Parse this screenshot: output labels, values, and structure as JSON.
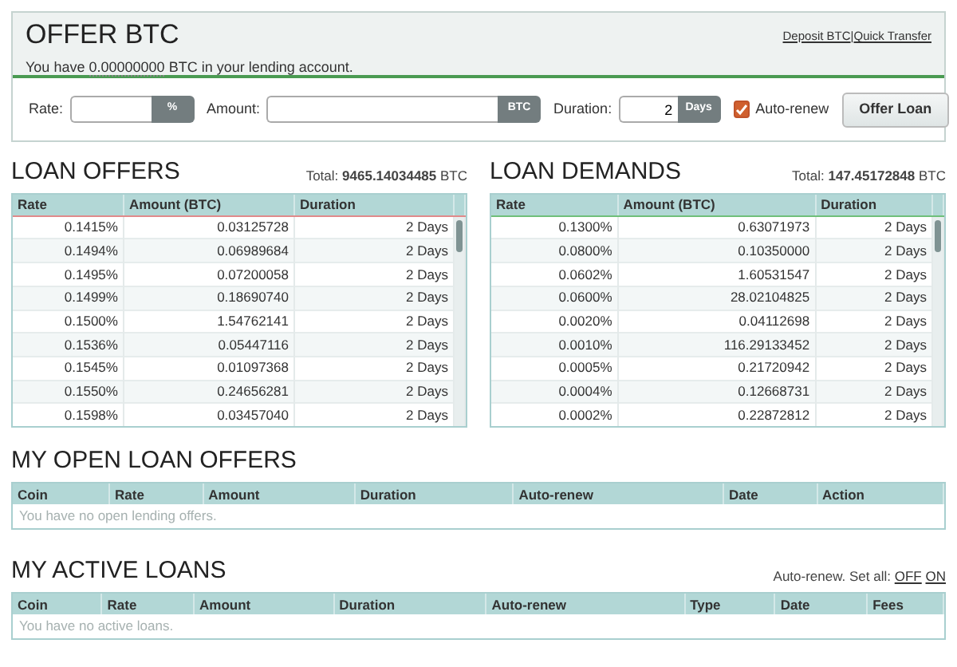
{
  "offer_panel": {
    "title": "OFFER BTC",
    "balance_text_before": "You have",
    "balance": "0.00000000",
    "balance_text_after": "BTC in your lending account.",
    "links": [
      "Deposit BTC",
      "Quick Transfer"
    ],
    "link_separator": "|",
    "form": {
      "rate_label": "Rate:",
      "rate_addon": "%",
      "amount_label": "Amount:",
      "amount_addon": "BTC",
      "duration_label": "Duration:",
      "duration_value": "2",
      "duration_addon": "Days",
      "auto_renew": {
        "label": "Auto-renew",
        "checked": true
      },
      "submit": "Offer Loan"
    }
  },
  "loan_offers": {
    "title": "LOAN OFFERS",
    "total_label": "Total:",
    "total": "9465.14034485",
    "total_unit": "BTC",
    "columns": [
      "Rate",
      "Amount (BTC)",
      "Duration"
    ],
    "rows": [
      [
        "0.1415%",
        "0.03125728",
        "2 Days"
      ],
      [
        "0.1494%",
        "0.06989684",
        "2 Days"
      ],
      [
        "0.1495%",
        "0.07200058",
        "2 Days"
      ],
      [
        "0.1499%",
        "0.18690740",
        "2 Days"
      ],
      [
        "0.1500%",
        "1.54762141",
        "2 Days"
      ],
      [
        "0.1536%",
        "0.05447116",
        "2 Days"
      ],
      [
        "0.1545%",
        "0.01097368",
        "2 Days"
      ],
      [
        "0.1550%",
        "0.24656281",
        "2 Days"
      ],
      [
        "0.1598%",
        "0.03457040",
        "2 Days"
      ]
    ]
  },
  "loan_demands": {
    "title": "LOAN DEMANDS",
    "total_label": "Total:",
    "total": "147.45172848",
    "total_unit": "BTC",
    "columns": [
      "Rate",
      "Amount (BTC)",
      "Duration"
    ],
    "rows": [
      [
        "0.1300%",
        "0.63071973",
        "2 Days"
      ],
      [
        "0.0800%",
        "0.10350000",
        "2 Days"
      ],
      [
        "0.0602%",
        "1.60531547",
        "2 Days"
      ],
      [
        "0.0600%",
        "28.02104825",
        "2 Days"
      ],
      [
        "0.0020%",
        "0.04112698",
        "2 Days"
      ],
      [
        "0.0010%",
        "116.29133452",
        "2 Days"
      ],
      [
        "0.0005%",
        "0.21720942",
        "2 Days"
      ],
      [
        "0.0004%",
        "0.12668731",
        "2 Days"
      ],
      [
        "0.0002%",
        "0.22872812",
        "2 Days"
      ]
    ]
  },
  "open_offers": {
    "title": "MY OPEN LOAN OFFERS",
    "columns": [
      "Coin",
      "Rate",
      "Amount",
      "Duration",
      "Auto-renew",
      "Date",
      "Action"
    ],
    "empty_text": "You have no open lending offers."
  },
  "active_loans": {
    "title": "MY ACTIVE LOANS",
    "set_all_label": "Auto-renew. Set all:",
    "set_all_links": [
      "OFF",
      "ON"
    ],
    "columns": [
      "Coin",
      "Rate",
      "Amount",
      "Duration",
      "Auto-renew",
      "Type",
      "Date",
      "Fees"
    ],
    "empty_text": "You have no active loans."
  }
}
